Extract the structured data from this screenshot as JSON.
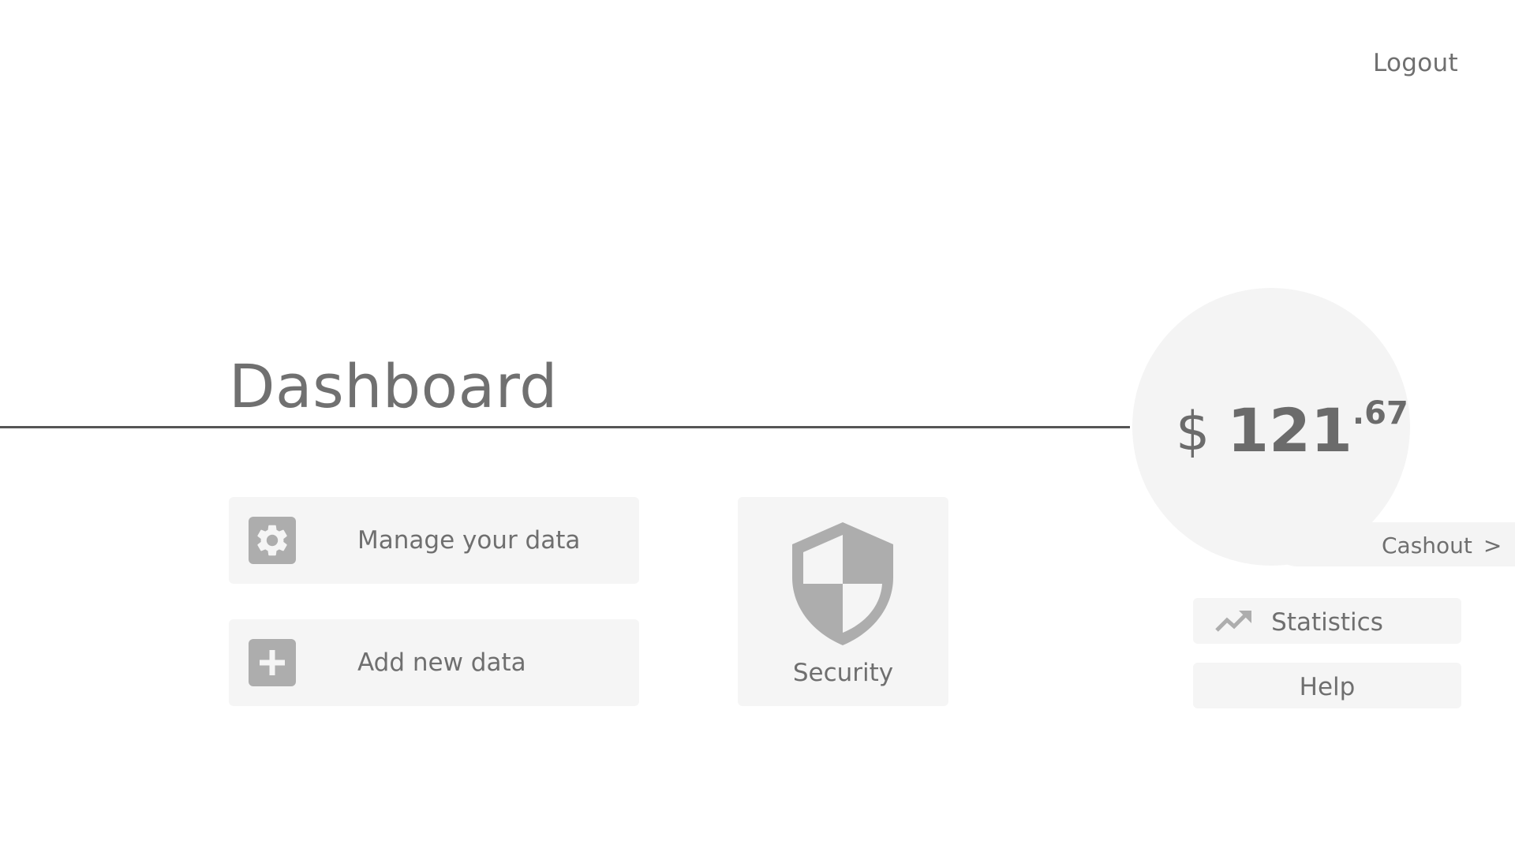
{
  "header": {
    "logout_label": "Logout"
  },
  "page": {
    "title": "Dashboard"
  },
  "actions": {
    "manage_label": "Manage your data",
    "add_label": "Add new data",
    "security_label": "Security"
  },
  "balance": {
    "currency": "$",
    "integer": "121",
    "decimal": ".67",
    "cashout_label": "Cashout",
    "cashout_chevron": ">"
  },
  "side_menu": {
    "statistics_label": "Statistics",
    "help_label": "Help"
  },
  "icons": {
    "manage": "gear-icon",
    "add": "plus-icon",
    "security": "shield-icon",
    "statistics": "trending-up-icon"
  },
  "colors": {
    "text": "#6f6f6f",
    "tile_bg": "#f5f5f5",
    "icon_gray": "#adadad",
    "divider": "#555555"
  }
}
